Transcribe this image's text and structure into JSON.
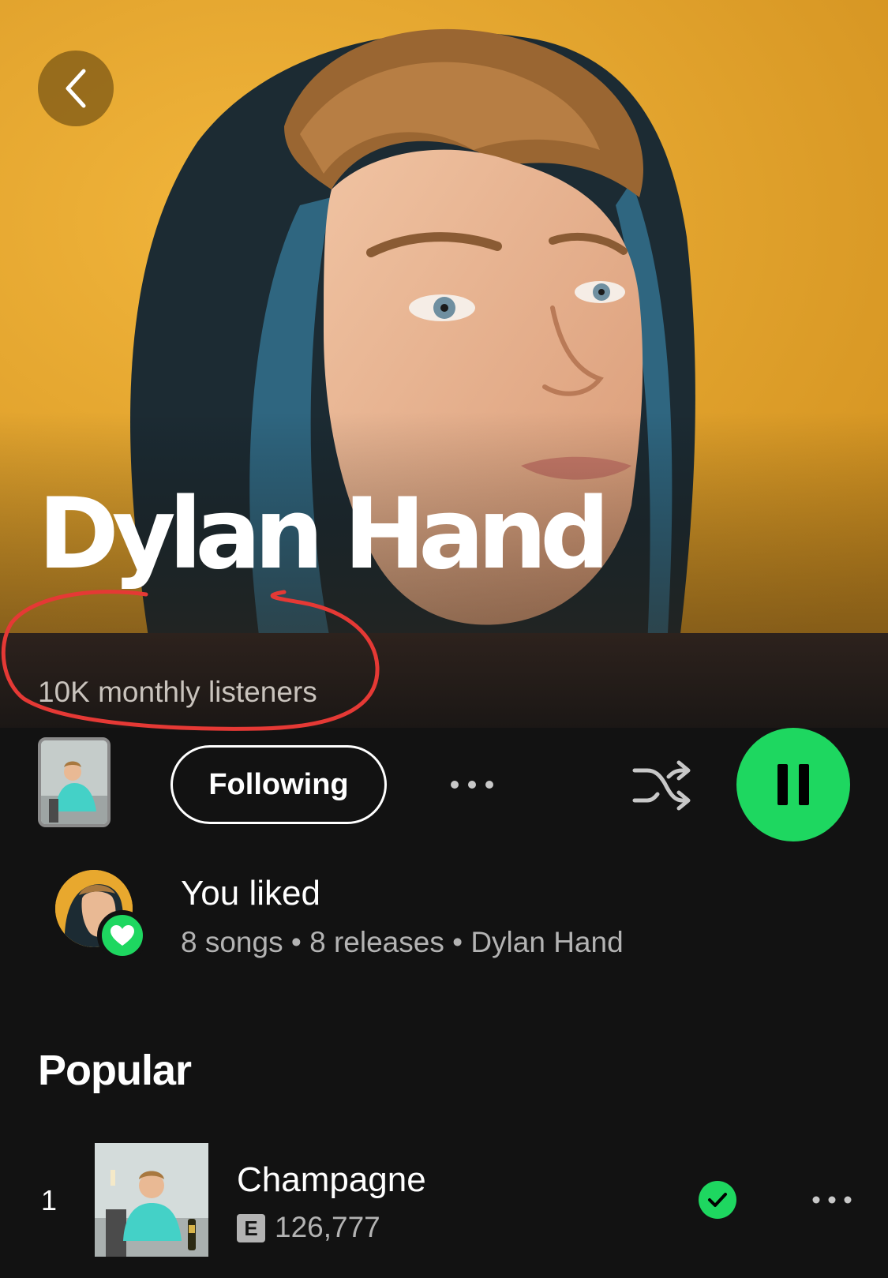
{
  "artist": {
    "name": "Dylan Hand",
    "monthly_listeners": "10K monthly listeners"
  },
  "controls": {
    "follow_label": "Following"
  },
  "liked": {
    "title": "You liked",
    "subtitle": "8 songs • 8 releases • Dylan Hand"
  },
  "popular": {
    "title": "Popular",
    "tracks": [
      {
        "index": "1",
        "title": "Champagne",
        "explicit": "E",
        "plays": "126,777"
      }
    ]
  },
  "colors": {
    "accent": "#1ed760",
    "background": "#121212",
    "hero_background": "#e8a82e",
    "annotation": "#e53935"
  },
  "icons": {
    "back": "chevron-left-icon",
    "more": "more-horizontal-icon",
    "shuffle": "shuffle-icon",
    "play_state": "pause-icon",
    "liked_badge": "heart-icon",
    "saved": "check-icon"
  }
}
